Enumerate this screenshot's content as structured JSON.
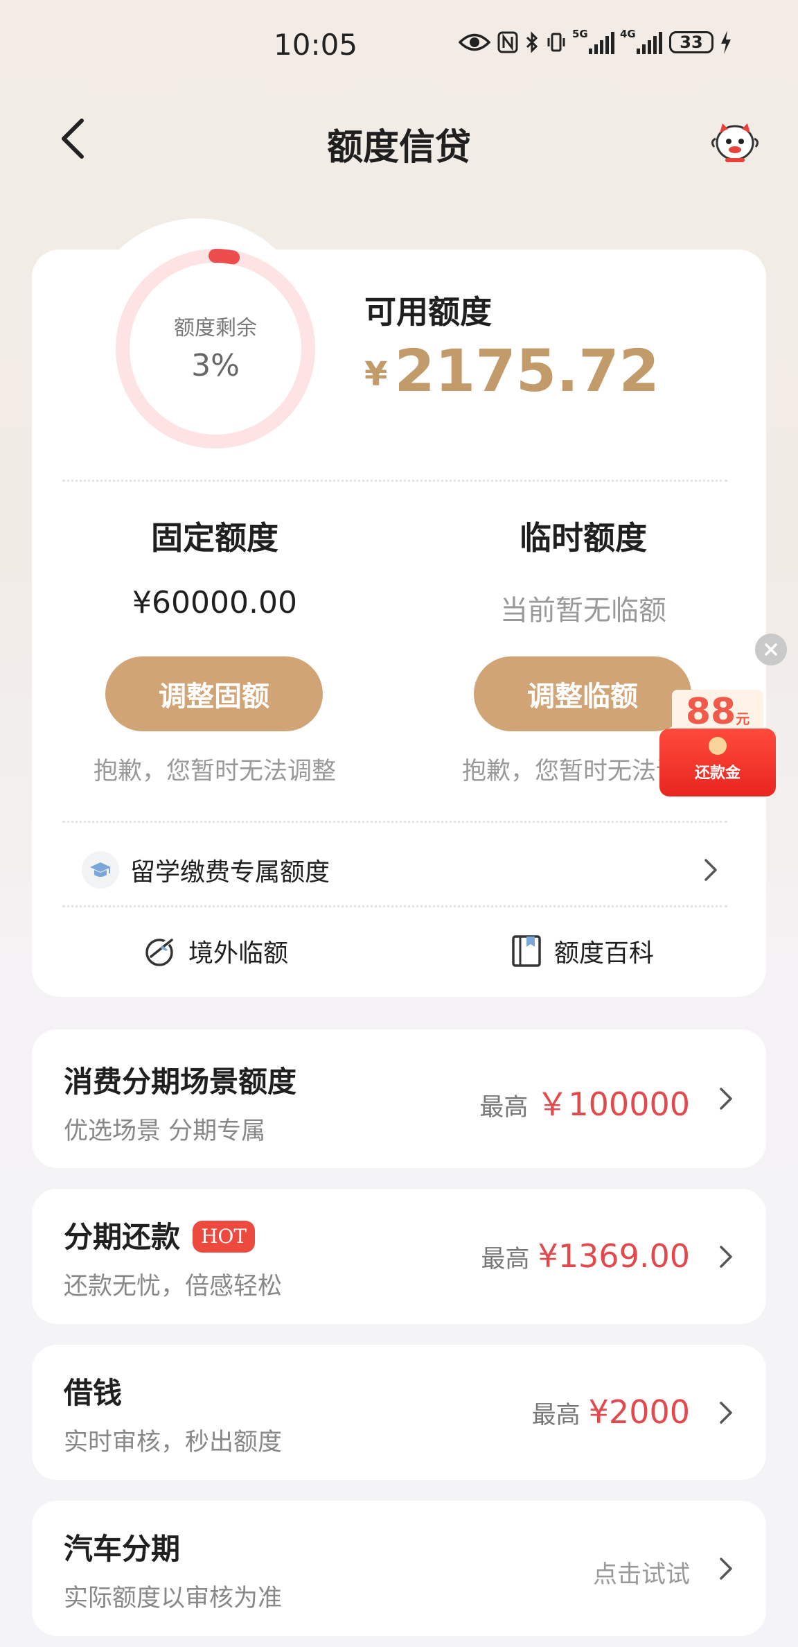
{
  "status_bar": {
    "time": "10:05",
    "signal1_label": "5G",
    "signal2_label": "4G",
    "battery": "33"
  },
  "nav": {
    "title": "额度信贷"
  },
  "quota": {
    "ring_label": "额度剩余",
    "ring_percent": "3%",
    "ring_fraction": 0.03,
    "available_label": "可用额度",
    "currency": "¥",
    "available_amount": "2175.72",
    "fixed": {
      "title": "固定额度",
      "value": "¥60000.00",
      "button": "调整固额",
      "note": "抱歉，您暂时无法调整"
    },
    "temporary": {
      "title": "临时额度",
      "value": "当前暂无临额",
      "button": "调整临额",
      "note": "抱歉，您暂时无法调整"
    },
    "study_label": "留学缴费专属额度",
    "tools": [
      {
        "label": "境外临额",
        "icon": "plane-globe-icon"
      },
      {
        "label": "额度百科",
        "icon": "book-icon"
      }
    ]
  },
  "red_packet": {
    "amount": "88",
    "unit": "元",
    "label": "还款金"
  },
  "cards": [
    {
      "title": "消费分期场景额度",
      "subtitle": "优选场景 分期专属",
      "prefix": "最高",
      "value": "￥100000"
    },
    {
      "title": "分期还款",
      "badge": "HOT",
      "subtitle": "还款无忧，倍感轻松",
      "prefix": "最高",
      "value": "¥1369.00"
    },
    {
      "title": "借钱",
      "subtitle": "实时审核，秒出额度",
      "prefix": "最高",
      "value": "¥2000"
    },
    {
      "title": "汽车分期",
      "subtitle": "实际额度以审核为准",
      "action": "点击试试"
    }
  ],
  "colors": {
    "accent_gold": "#c29b6b",
    "button_gold": "#d0a474",
    "value_red": "#e2484c",
    "hot_red": "#ec4a3e"
  }
}
